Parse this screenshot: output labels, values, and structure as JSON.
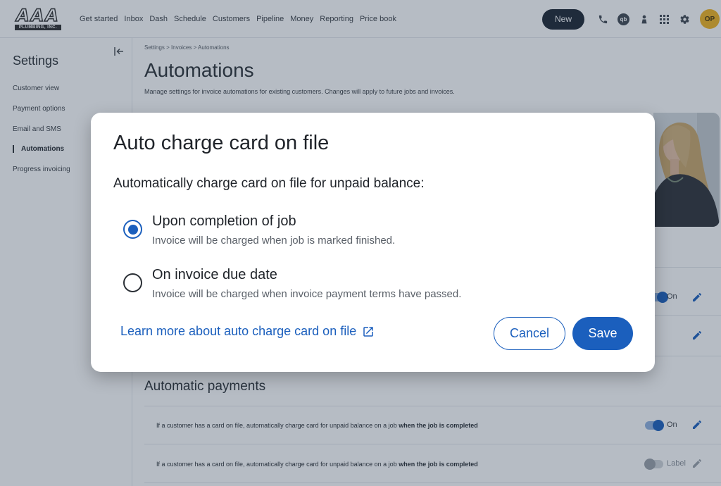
{
  "brand": {
    "logo_mark": "AAA",
    "logo_sub": "PLUMBING, INC."
  },
  "nav": {
    "items": [
      "Get started",
      "Inbox",
      "Dash",
      "Schedule",
      "Customers",
      "Pipeline",
      "Money",
      "Reporting",
      "Price book"
    ]
  },
  "header": {
    "new_label": "New",
    "qb_label": "qb",
    "avatar_initials": "OP"
  },
  "sidebar": {
    "title": "Settings",
    "items": [
      {
        "label": "Customer view",
        "active": false
      },
      {
        "label": "Payment options",
        "active": false
      },
      {
        "label": "Email and SMS",
        "active": false
      },
      {
        "label": "Automations",
        "active": true
      },
      {
        "label": "Progress invoicing",
        "active": false
      }
    ]
  },
  "main": {
    "breadcrumb": "Settings > Invoices > Automations",
    "title": "Automations",
    "description": "Manage settings for invoice automations for existing customers. Changes will apply to future jobs and invoices.",
    "section_title": "Automatic payments",
    "visible_toggle_label": "On",
    "rules": [
      {
        "text_prefix": "If a customer has a card on file, automatically charge card for unpaid balance on a job ",
        "text_bold": "when the job is completed",
        "toggle": "on",
        "toggle_label": "On"
      },
      {
        "text_prefix": "If a customer has a card on file, automatically charge card for unpaid balance on a job ",
        "text_bold": "when the job is completed",
        "toggle": "off",
        "toggle_label": "Label"
      }
    ]
  },
  "modal": {
    "title": "Auto charge card on file",
    "subtitle": "Automatically charge card on file for unpaid balance:",
    "options": [
      {
        "label": "Upon completion of job",
        "hint": "Invoice will be charged when job is marked finished.",
        "checked": true
      },
      {
        "label": "On invoice due date",
        "hint": "Invoice will be charged when invoice payment terms have passed.",
        "checked": false
      }
    ],
    "learn_more": "Learn more about auto charge card on file",
    "cancel_label": "Cancel",
    "save_label": "Save"
  },
  "colors": {
    "accent": "#1b5fbd",
    "dark_button": "#1b2330",
    "avatar": "#f2b31e",
    "overlay": "#2a3a52"
  }
}
